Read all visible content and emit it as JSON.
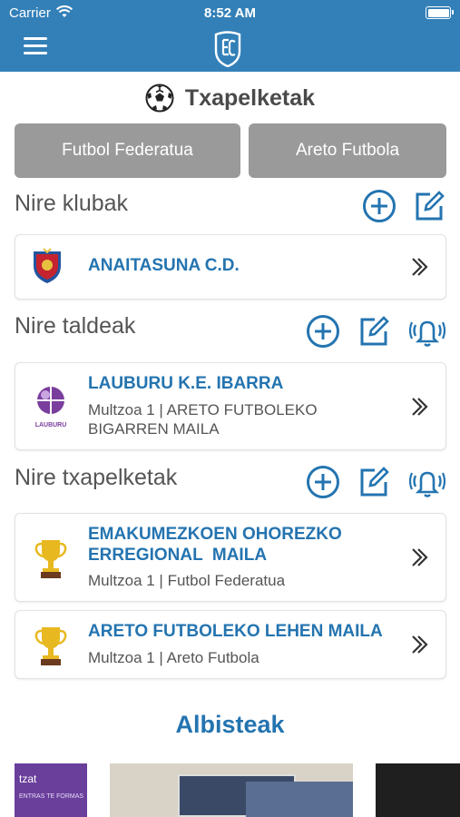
{
  "status": {
    "carrier": "Carrier",
    "time": "8:52 AM"
  },
  "header": {
    "title": "Txapelketak"
  },
  "tabs": [
    {
      "label": "Futbol Federatua"
    },
    {
      "label": "Areto Futbola"
    }
  ],
  "sections": {
    "clubs": {
      "label": "Nire klubak"
    },
    "teams": {
      "label": "Nire taldeak"
    },
    "tournaments": {
      "label": "Nire txapelketak"
    }
  },
  "clubs": [
    {
      "name": "ANAITASUNA C.D."
    }
  ],
  "teams": [
    {
      "name": "LAUBURU K.E. IBARRA",
      "line1": "Multzoa 1 | ARETO FUTBOLEKO",
      "line2": "BIGARREN MAILA",
      "logo_text": "LAUBURU"
    }
  ],
  "tournaments": [
    {
      "name_line1": "EMAKUMEZKOEN OHOREZKO",
      "name_line2": "ERREGIONAL  MAILA",
      "sub": "Multzoa 1 | Futbol Federatua"
    },
    {
      "name_line1": "ARETO FUTBOLEKO LEHEN MAILA",
      "sub": "Multzoa 1 | Areto Futbola"
    }
  ],
  "news": {
    "title": "Albisteak",
    "item1_text": "tzat",
    "item1_small": "ENTRAS TE FORMAS"
  },
  "colors": {
    "brand": "#3380b8",
    "accent": "#2474b0",
    "tab_bg": "#9a9a9a",
    "trophy": "#e8b820"
  },
  "icons": [
    "wifi-icon",
    "battery-icon",
    "menu-icon",
    "logo-icon",
    "soccer-ball-icon",
    "add-circle-icon",
    "edit-icon",
    "bell-icon",
    "chevron-right-icon",
    "trophy-icon"
  ]
}
